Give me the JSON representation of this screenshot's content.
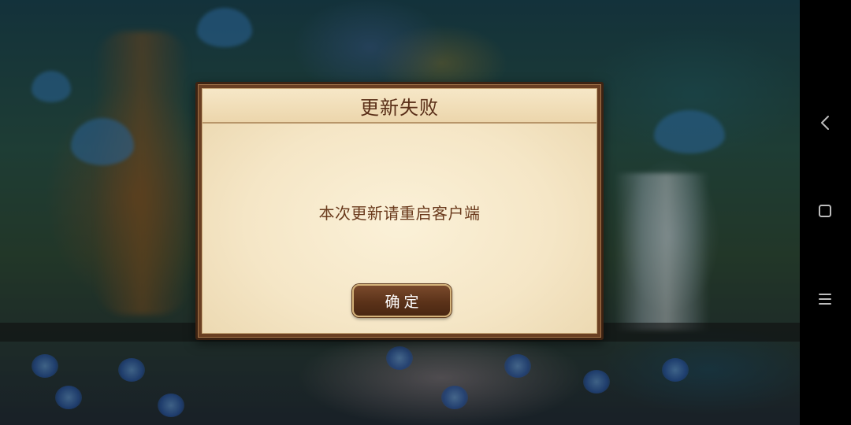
{
  "dialog": {
    "title": "更新失败",
    "message": "本次更新请重启客户端",
    "confirm_label": "确定"
  },
  "nav_bar": {
    "back_icon": "chevron-left-icon",
    "home_icon": "square-icon",
    "menu_icon": "menu-icon"
  },
  "colors": {
    "dialog_frame": "#6a3f22",
    "dialog_paper": "#f5e6c6",
    "title_text": "#5a2f18",
    "message_text": "#6a3a1c",
    "button_fill": "#5b3219",
    "button_border": "#d4b27a",
    "nav_bar_bg": "#000000",
    "nav_icon": "#bdbdbd"
  }
}
